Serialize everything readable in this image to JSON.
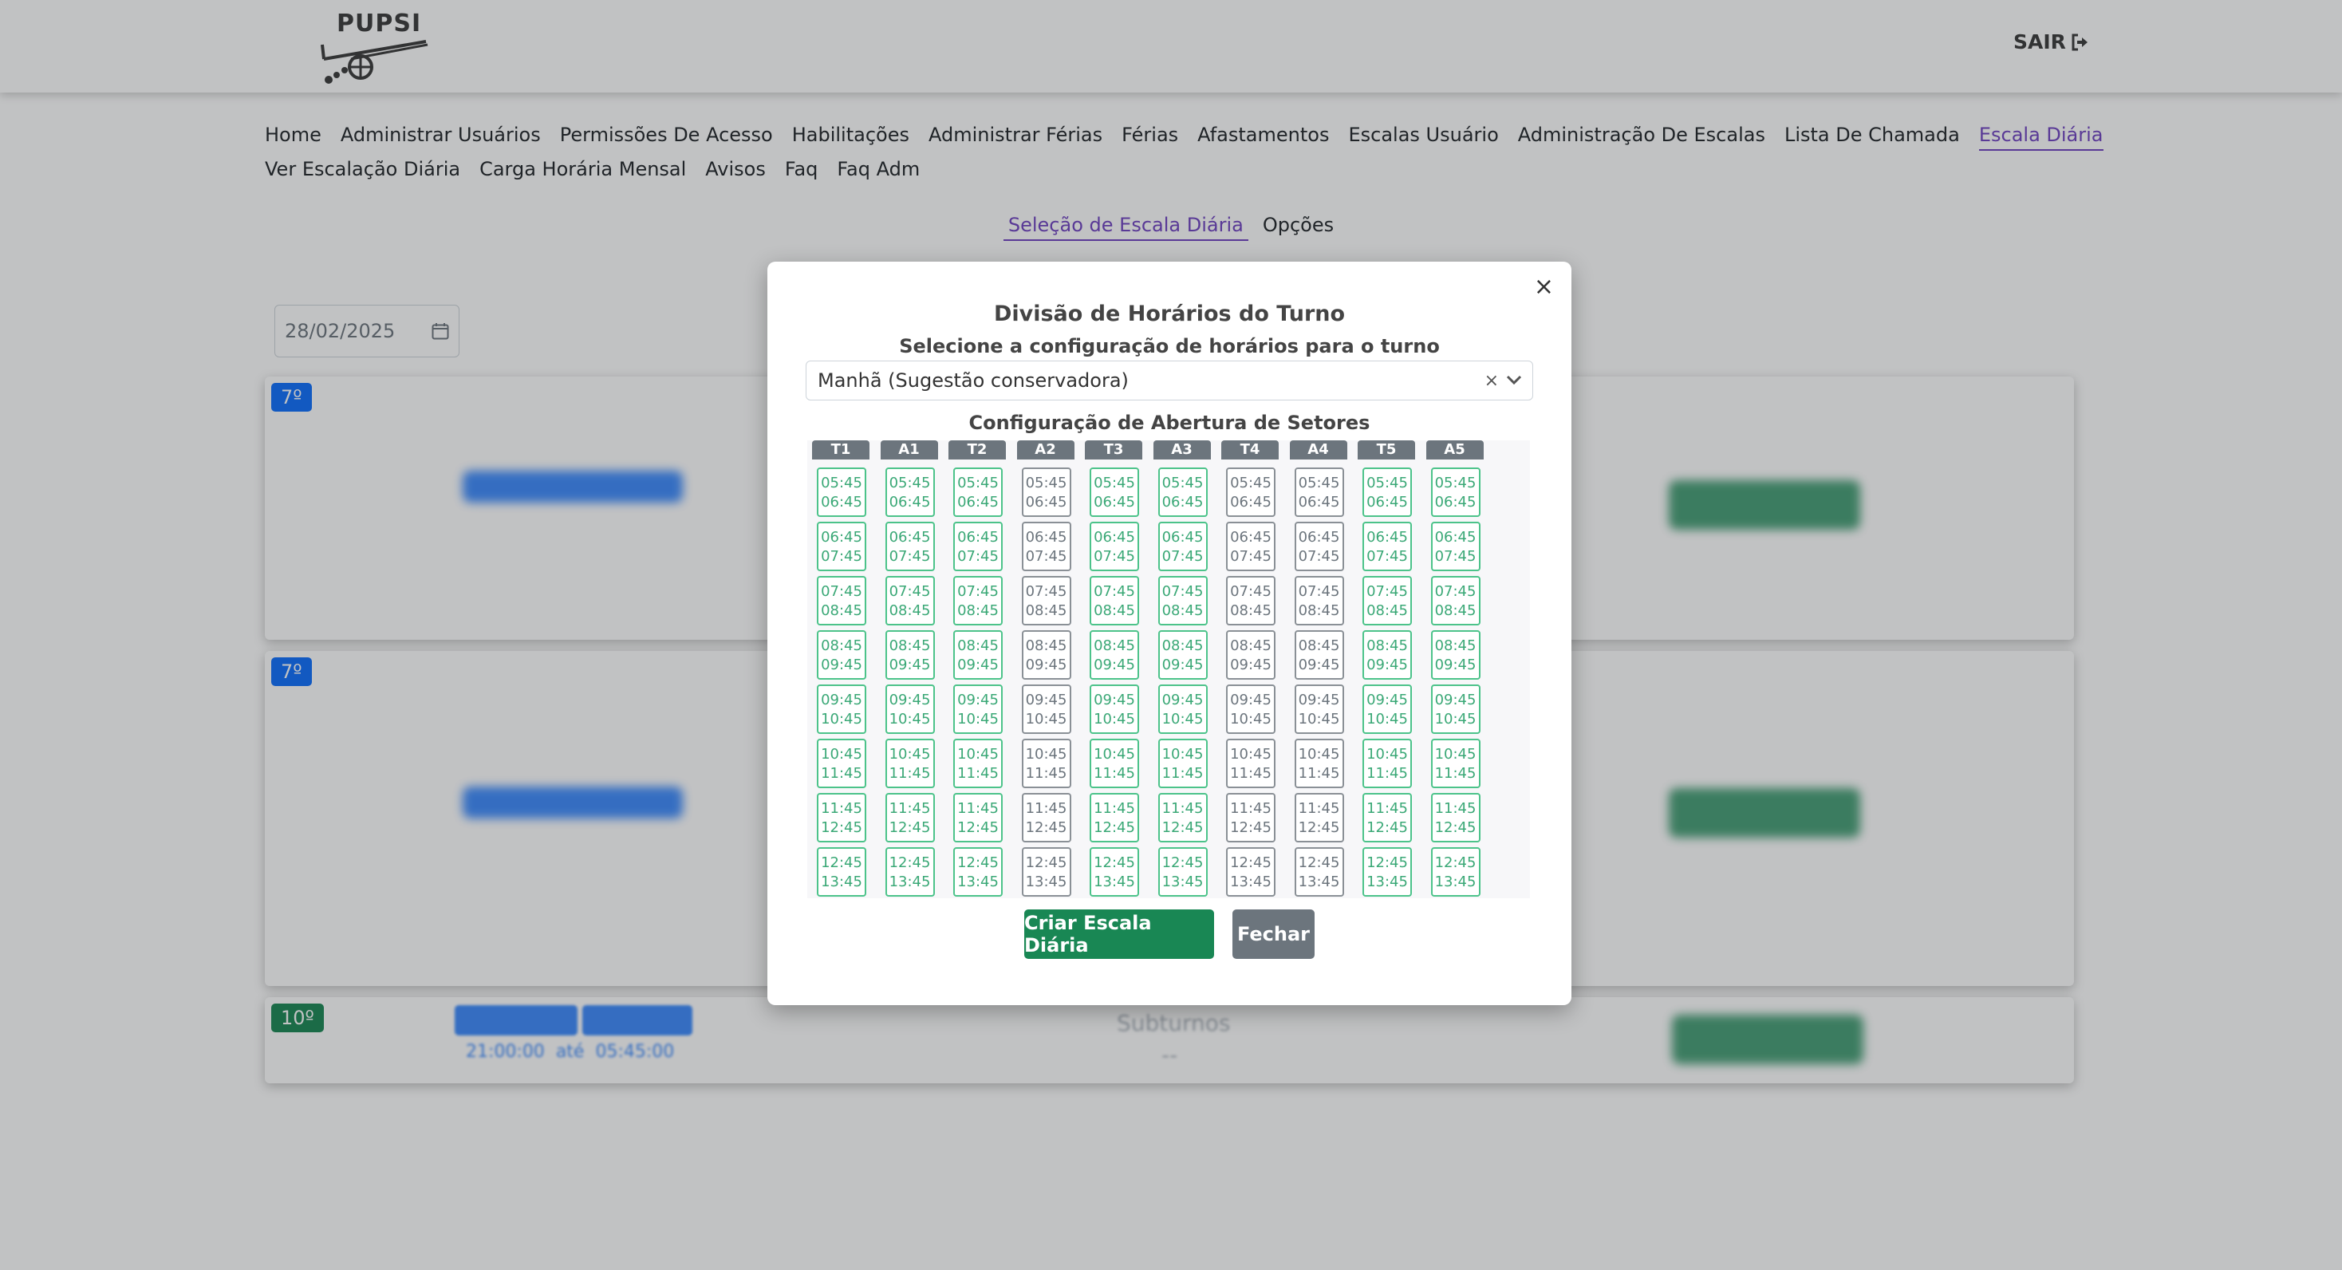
{
  "header": {
    "logo_text": "PUPSI",
    "logout_label": "SAIR",
    "logout_icon": "sign-out-icon"
  },
  "nav": {
    "row1": [
      "Home",
      "Administrar Usuários",
      "Permissões De Acesso",
      "Habilitações",
      "Administrar Férias",
      "Férias",
      "Afastamentos",
      "Escalas Usuário",
      "Administração De Escalas",
      "Lista De Chamada",
      "Escala Diária"
    ],
    "row2": [
      "Ver Escalação Diária",
      "Carga Horária Mensal",
      "Avisos",
      "Faq",
      "Faq Adm"
    ],
    "active": "Escala Diária"
  },
  "subtabs": {
    "items": [
      "Seleção de Escala Diária",
      "Opções"
    ],
    "active": "Seleção de Escala Diária"
  },
  "date_filter": {
    "value": "28/02/2025"
  },
  "cards": [
    {
      "badge": "7º",
      "badge_color": "#0d6efd"
    },
    {
      "badge": "7º",
      "badge_color": "#0d6efd"
    },
    {
      "badge": "10º",
      "badge_color": "#198754",
      "chips": [
        "",
        ""
      ],
      "time_from": "21:00:00",
      "time_sep": "até",
      "time_to": "05:45:00",
      "center_title": "Subturnos",
      "center_value": "--"
    }
  ],
  "modal": {
    "title": "Divisão de Horários do Turno",
    "subtitle": "Selecione a configuração de horários para o turno",
    "select_value": "Manhã (Sugestão conservadora)",
    "clear_symbol": "×",
    "config_title": "Configuração de Abertura de Setores",
    "create_button": "Criar Escala Diária",
    "close_button": "Fechar",
    "close_symbol": "×",
    "columns": [
      {
        "label": "T1",
        "state": "open"
      },
      {
        "label": "A1",
        "state": "open"
      },
      {
        "label": "T2",
        "state": "open"
      },
      {
        "label": "A2",
        "state": "closed"
      },
      {
        "label": "T3",
        "state": "open"
      },
      {
        "label": "A3",
        "state": "open"
      },
      {
        "label": "T4",
        "state": "closed"
      },
      {
        "label": "A4",
        "state": "closed"
      },
      {
        "label": "T5",
        "state": "open"
      },
      {
        "label": "A5",
        "state": "open"
      }
    ],
    "slots": [
      [
        "05:45",
        "06:45"
      ],
      [
        "06:45",
        "07:45"
      ],
      [
        "07:45",
        "08:45"
      ],
      [
        "08:45",
        "09:45"
      ],
      [
        "09:45",
        "10:45"
      ],
      [
        "10:45",
        "11:45"
      ],
      [
        "11:45",
        "12:45"
      ],
      [
        "12:45",
        "13:45"
      ]
    ],
    "colors": {
      "open": "#3aa876",
      "closed": "#6c757d"
    }
  }
}
